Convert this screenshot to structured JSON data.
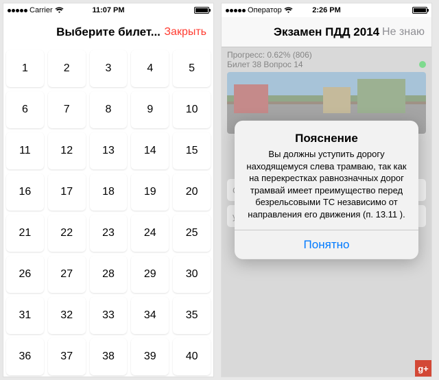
{
  "left": {
    "status": {
      "carrier": "Carrier",
      "time": "11:07 PM"
    },
    "nav": {
      "title": "Выберите билет...",
      "close": "Закрыть"
    },
    "tickets": [
      "1",
      "2",
      "3",
      "4",
      "5",
      "6",
      "7",
      "8",
      "9",
      "10",
      "11",
      "12",
      "13",
      "14",
      "15",
      "16",
      "17",
      "18",
      "19",
      "20",
      "21",
      "22",
      "23",
      "24",
      "25",
      "26",
      "27",
      "28",
      "29",
      "30",
      "31",
      "32",
      "33",
      "34",
      "35",
      "36",
      "37",
      "38",
      "39",
      "40"
    ]
  },
  "right": {
    "status": {
      "carrier": "Оператор",
      "time": "2:26 PM"
    },
    "nav": {
      "title": "Экзамен ПДД 2014",
      "skip": "Не знаю"
    },
    "progress": "Прогресс: 0.62% (806)",
    "question": "Билет 38 Вопрос 14",
    "optA": "С",
    "optB": "у",
    "alert": {
      "title": "Пояснение",
      "body": "Вы должны уступить дорогу находящемуся слева трамваю, так как на перекрестках равнозначных дорог трамвай имеет преимущество перед безрельсовыми ТС независимо от направления его движения (п. 13.11 ).",
      "button": "Понятно"
    }
  },
  "gplus": "g+"
}
